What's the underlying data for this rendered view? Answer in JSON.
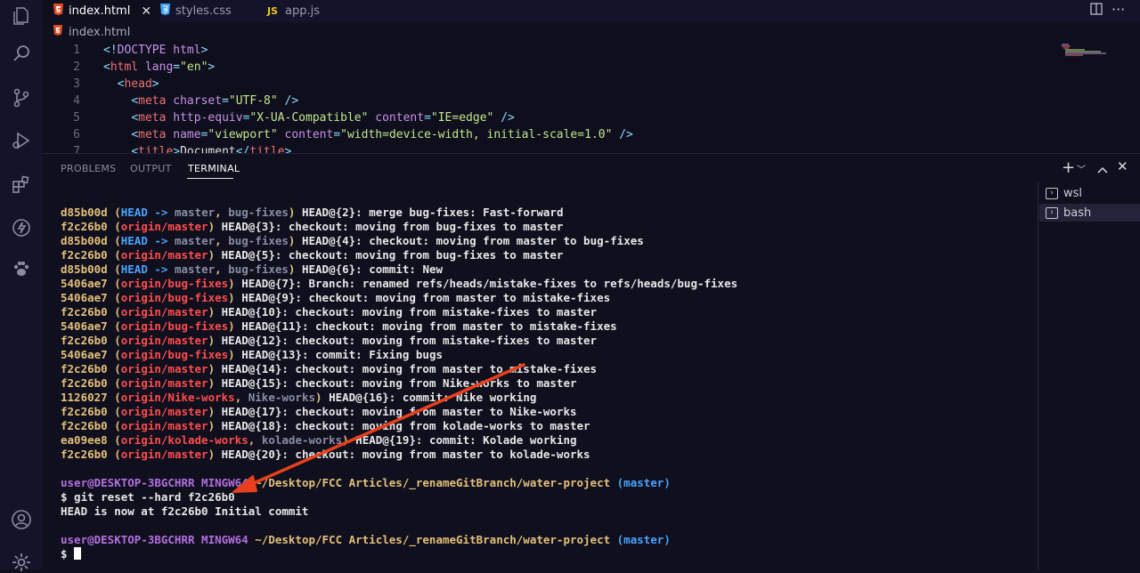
{
  "tabs": [
    {
      "label": "index.html",
      "icon": "html5-icon",
      "active": true,
      "close": "✕"
    },
    {
      "label": "styles.css",
      "icon": "css3-icon",
      "active": false
    },
    {
      "label": "app.js",
      "icon": "js-icon",
      "active": false,
      "icon_text": "JS"
    }
  ],
  "breadcrumb": "index.html",
  "editor": {
    "lines": [
      {
        "n": "1"
      },
      {
        "n": "2"
      },
      {
        "n": "3"
      },
      {
        "n": "4"
      },
      {
        "n": "5"
      },
      {
        "n": "6"
      },
      {
        "n": "7"
      }
    ]
  },
  "panel": {
    "tabs": [
      "PROBLEMS",
      "OUTPUT",
      "TERMINAL"
    ],
    "active_tab": "TERMINAL"
  },
  "terminal_list": [
    "wsl",
    "bash"
  ],
  "terminal": {
    "reflog": [
      {
        "hash": "d85b00d",
        "refs": [
          [
            "b",
            "HEAD -> "
          ],
          [
            "gr",
            "master"
          ],
          [
            "h",
            ", "
          ],
          [
            "gr",
            "bug-fixes"
          ]
        ],
        "rest": " HEAD@{2}: merge bug-fixes: Fast-forward"
      },
      {
        "hash": "f2c26b0",
        "refs": [
          [
            "p",
            "origin/master"
          ]
        ],
        "rest": " HEAD@{3}: checkout: moving from bug-fixes to master"
      },
      {
        "hash": "d85b00d",
        "refs": [
          [
            "b",
            "HEAD -> "
          ],
          [
            "gr",
            "master"
          ],
          [
            "h",
            ", "
          ],
          [
            "gr",
            "bug-fixes"
          ]
        ],
        "rest": " HEAD@{4}: checkout: moving from master to bug-fixes"
      },
      {
        "hash": "f2c26b0",
        "refs": [
          [
            "p",
            "origin/master"
          ]
        ],
        "rest": " HEAD@{5}: checkout: moving from bug-fixes to master"
      },
      {
        "hash": "d85b00d",
        "refs": [
          [
            "b",
            "HEAD -> "
          ],
          [
            "gr",
            "master"
          ],
          [
            "h",
            ", "
          ],
          [
            "gr",
            "bug-fixes"
          ]
        ],
        "rest": " HEAD@{6}: commit: New"
      },
      {
        "hash": "5406ae7",
        "refs": [
          [
            "p",
            "origin/bug-fixes"
          ]
        ],
        "rest": " HEAD@{7}: Branch: renamed refs/heads/mistake-fixes to refs/heads/bug-fixes"
      },
      {
        "hash": "5406ae7",
        "refs": [
          [
            "p",
            "origin/bug-fixes"
          ]
        ],
        "rest": " HEAD@{9}: checkout: moving from master to mistake-fixes"
      },
      {
        "hash": "f2c26b0",
        "refs": [
          [
            "p",
            "origin/master"
          ]
        ],
        "rest": " HEAD@{10}: checkout: moving from mistake-fixes to master"
      },
      {
        "hash": "5406ae7",
        "refs": [
          [
            "p",
            "origin/bug-fixes"
          ]
        ],
        "rest": " HEAD@{11}: checkout: moving from master to mistake-fixes"
      },
      {
        "hash": "f2c26b0",
        "refs": [
          [
            "p",
            "origin/master"
          ]
        ],
        "rest": " HEAD@{12}: checkout: moving from mistake-fixes to master"
      },
      {
        "hash": "5406ae7",
        "refs": [
          [
            "p",
            "origin/bug-fixes"
          ]
        ],
        "rest": " HEAD@{13}: commit: Fixing bugs"
      },
      {
        "hash": "f2c26b0",
        "refs": [
          [
            "p",
            "origin/master"
          ]
        ],
        "rest": " HEAD@{14}: checkout: moving from master to mistake-fixes"
      },
      {
        "hash": "f2c26b0",
        "refs": [
          [
            "p",
            "origin/master"
          ]
        ],
        "rest": " HEAD@{15}: checkout: moving from Nike-works to master"
      },
      {
        "hash": "1126027",
        "refs": [
          [
            "p",
            "origin/Nike-works"
          ],
          [
            "h",
            ", "
          ],
          [
            "gr",
            "Nike-works"
          ]
        ],
        "rest": " HEAD@{16}: commit: Nike working"
      },
      {
        "hash": "f2c26b0",
        "refs": [
          [
            "p",
            "origin/master"
          ]
        ],
        "rest": " HEAD@{17}: checkout: moving from master to Nike-works"
      },
      {
        "hash": "f2c26b0",
        "refs": [
          [
            "p",
            "origin/master"
          ]
        ],
        "rest": " HEAD@{18}: checkout: moving from kolade-works to master"
      },
      {
        "hash": "ea09ee8",
        "refs": [
          [
            "p",
            "origin/kolade-works"
          ],
          [
            "h",
            ", "
          ],
          [
            "gr",
            "kolade-works"
          ]
        ],
        "rest": " HEAD@{19}: commit: Kolade working"
      },
      {
        "hash": "f2c26b0",
        "refs": [
          [
            "p",
            "origin/master"
          ]
        ],
        "rest": " HEAD@{20}: checkout: moving from master to kolade-works"
      }
    ],
    "prompt": {
      "user": "user@DESKTOP-3BGCHRR",
      "shell": "MINGW64",
      "path": "~/Desktop/FCC Articles/_renameGitBranch/water-project",
      "branch": "(master)"
    },
    "command": "$ git reset --hard f2c26b0",
    "output": "HEAD is now at f2c26b0 Initial commit",
    "prompt_symbol": "$"
  },
  "colors": {
    "annotation_arrow": "#e8401c",
    "html_icon": "#e44d26",
    "css_icon": "#42a5f5",
    "js_icon": "#f0c419"
  }
}
